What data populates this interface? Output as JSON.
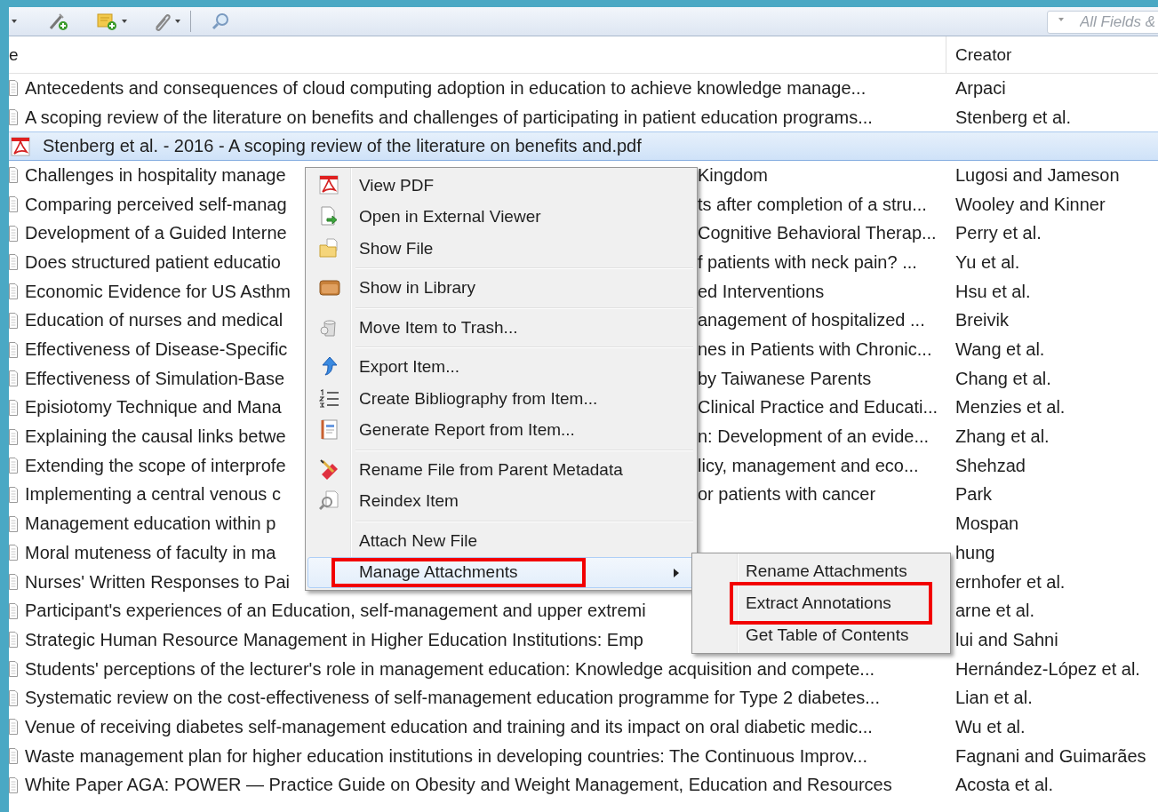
{
  "search": {
    "placeholder": "All Fields &"
  },
  "columns": [
    {
      "label": "e"
    },
    {
      "label": "Creator"
    }
  ],
  "rows": [
    {
      "kind": "document",
      "selected": false,
      "title": "Antecedents and consequences of cloud computing adoption in education to achieve knowledge manage...",
      "creator": "Arpaci"
    },
    {
      "kind": "document",
      "selected": false,
      "title": "A scoping review of the literature on benefits and challenges of participating in patient education programs...",
      "creator": "Stenberg et al."
    },
    {
      "kind": "pdf",
      "selected": true,
      "title": "Stenberg et al. - 2016 - A scoping review of the literature on benefits and.pdf"
    },
    {
      "kind": "document",
      "selected": false,
      "title": "Challenges in hospitality manage",
      "title_continued": "Kingdom",
      "creator": "Lugosi and Jameson"
    },
    {
      "kind": "document",
      "selected": false,
      "title": "Comparing perceived self-manag",
      "title_continued": "ts after completion of a stru...",
      "creator": "Wooley and Kinner"
    },
    {
      "kind": "document",
      "selected": false,
      "title": "Development of a Guided Interne",
      "title_continued": "Cognitive Behavioral Therap...",
      "creator": "Perry et al."
    },
    {
      "kind": "document",
      "selected": false,
      "title": "Does structured patient educatio",
      "title_continued": "f patients with neck pain? ...",
      "creator": "Yu et al."
    },
    {
      "kind": "document",
      "selected": false,
      "title": "Economic Evidence for US Asthm",
      "title_continued": "ed Interventions",
      "creator": "Hsu et al."
    },
    {
      "kind": "document",
      "selected": false,
      "title": "Education of nurses and medical",
      "title_continued": "anagement of hospitalized ...",
      "creator": "Breivik"
    },
    {
      "kind": "document",
      "selected": false,
      "title": "Effectiveness of Disease-Specific",
      "title_continued": "nes in Patients with Chronic...",
      "creator": "Wang et al."
    },
    {
      "kind": "document",
      "selected": false,
      "title": "Effectiveness of Simulation-Base",
      "title_continued": "by Taiwanese Parents",
      "creator": "Chang et al."
    },
    {
      "kind": "document",
      "selected": false,
      "title": "Episiotomy Technique and Mana",
      "title_continued": "Clinical Practice and Educati...",
      "creator": "Menzies et al."
    },
    {
      "kind": "document",
      "selected": false,
      "title": "Explaining the causal links betwe",
      "title_continued": "n: Development of an evide...",
      "creator": "Zhang et al."
    },
    {
      "kind": "document",
      "selected": false,
      "title": "Extending the scope of interprofe",
      "title_continued": "licy, management and eco...",
      "creator": "Shehzad"
    },
    {
      "kind": "document",
      "selected": false,
      "title": "Implementing a central venous c",
      "title_continued": "or patients with cancer",
      "creator": "Park"
    },
    {
      "kind": "document",
      "selected": false,
      "title": "Management education within p",
      "creator": "Mospan"
    },
    {
      "kind": "document",
      "selected": false,
      "title": "Moral muteness of faculty in ma",
      "creator": "hung"
    },
    {
      "kind": "document",
      "selected": false,
      "title": "Nurses' Written Responses to Pai",
      "creator": "ernhofer et al."
    },
    {
      "kind": "document",
      "selected": false,
      "title": "Participant's experiences of an Education, self-management and upper extremi",
      "creator": "arne et al."
    },
    {
      "kind": "document",
      "selected": false,
      "title": "Strategic Human Resource Management in Higher Education Institutions: Emp",
      "creator": "lui and Sahni"
    },
    {
      "kind": "document",
      "selected": false,
      "title": "Students' perceptions of the lecturer's role in management education: Knowledge acquisition and compete...",
      "creator": "Hernández-López et al."
    },
    {
      "kind": "document",
      "selected": false,
      "title": "Systematic review on the cost-effectiveness of self-management education programme for Type 2 diabetes...",
      "creator": "Lian et al."
    },
    {
      "kind": "document",
      "selected": false,
      "title": "Venue of receiving diabetes self-management education and training and its impact on oral diabetic medic...",
      "creator": "Wu et al."
    },
    {
      "kind": "document",
      "selected": false,
      "title": "Waste management plan for higher education institutions in developing countries: The Continuous Improv...",
      "creator": "Fagnani and Guimarães"
    },
    {
      "kind": "document",
      "selected": false,
      "title": "White Paper AGA: POWER — Practice Guide on Obesity and Weight Management, Education and Resources",
      "creator": "Acosta et al."
    }
  ],
  "context_menu": {
    "groups": [
      [
        {
          "label": "View PDF",
          "selected": false,
          "has_submenu": false,
          "annotated": false
        },
        {
          "label": "Open in External Viewer",
          "selected": false,
          "has_submenu": false,
          "annotated": false
        },
        {
          "label": "Show File",
          "selected": false,
          "has_submenu": false,
          "annotated": false
        }
      ],
      [
        {
          "label": "Show in Library",
          "selected": false,
          "has_submenu": false,
          "annotated": false
        }
      ],
      [
        {
          "label": "Move Item to Trash...",
          "selected": false,
          "has_submenu": false,
          "annotated": false
        }
      ],
      [
        {
          "label": "Export Item...",
          "selected": false,
          "has_submenu": false,
          "annotated": false
        },
        {
          "label": "Create Bibliography from Item...",
          "selected": false,
          "has_submenu": false,
          "annotated": false
        },
        {
          "label": "Generate Report from Item...",
          "selected": false,
          "has_submenu": false,
          "annotated": false
        }
      ],
      [
        {
          "label": "Rename File from Parent Metadata",
          "selected": false,
          "has_submenu": false,
          "annotated": false
        },
        {
          "label": "Reindex Item",
          "selected": false,
          "has_submenu": false,
          "annotated": false
        }
      ],
      [
        {
          "label": "Attach New File",
          "selected": false,
          "has_submenu": false,
          "annotated": false
        },
        {
          "label": "Manage Attachments",
          "selected": true,
          "has_submenu": true,
          "annotated": true
        }
      ]
    ]
  },
  "submenu": {
    "items": [
      {
        "label": "Rename Attachments",
        "annotated": false
      },
      {
        "label": "Extract Annotations",
        "annotated": true
      },
      {
        "label": "Get Table of Contents",
        "annotated": false
      }
    ]
  }
}
